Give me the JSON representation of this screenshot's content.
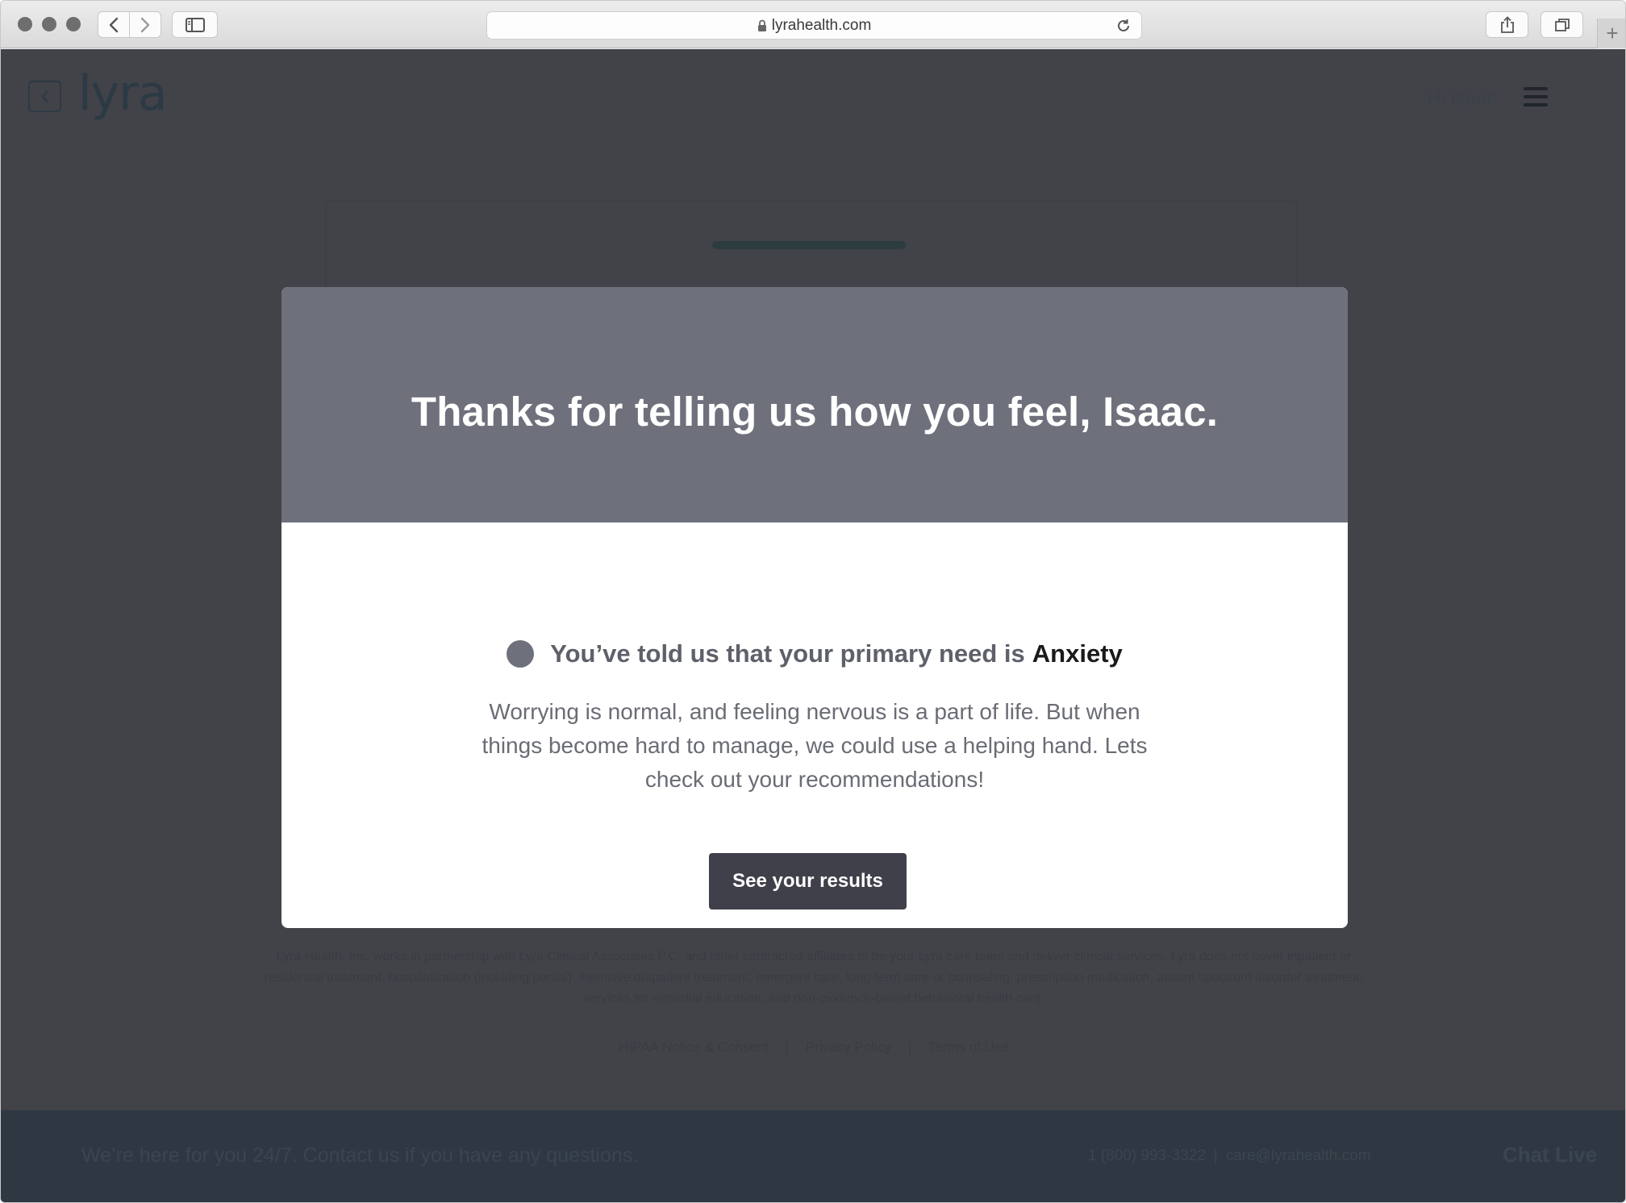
{
  "browser": {
    "url": "lyrahealth.com",
    "new_tab_label": "+"
  },
  "header": {
    "logo_text": "lyra",
    "greeting": "Hi Isaac"
  },
  "modal": {
    "title": "Thanks for telling us how you feel, Isaac.",
    "need_prefix": "You’ve told us that your primary need is",
    "need_value": "Anxiety",
    "description": "Worrying is normal, and feeling nervous is a part of life. But when things become hard to manage, we could use a helping hand. Lets check out your recommendations!",
    "button_label": "See your results"
  },
  "disclaimer": "Lyra Health, Inc. works in partnership with Lyra Clinical Associates P.C. and other contracted affiliates to be your Lyra care team and deliver clinical services. Lyra does not cover inpatient or residential treatment, hospitalization (including partial), intensive outpatient treatment, emergent care, long-term care or counseling, prescription medication, autism spectrum disorder treatment, services for remedial education, and non-evidence-based behavioral health care.",
  "footer_links": {
    "hipaa": "HIPAA Notice & Consent",
    "privacy": "Privacy Policy",
    "terms": "Terms of Use",
    "separator": "|"
  },
  "bottom_bar": {
    "message": "We’re here for you 24/7. Contact us if you have any questions.",
    "phone": "1 (800) 993-3322",
    "separator": "|",
    "email": "care@lyrahealth.com",
    "chat": "Chat Live"
  },
  "colors": {
    "overlay": "#424249",
    "modal_header": "#6e707c",
    "button": "#40404a",
    "bottom_bar": "#2f3842"
  }
}
